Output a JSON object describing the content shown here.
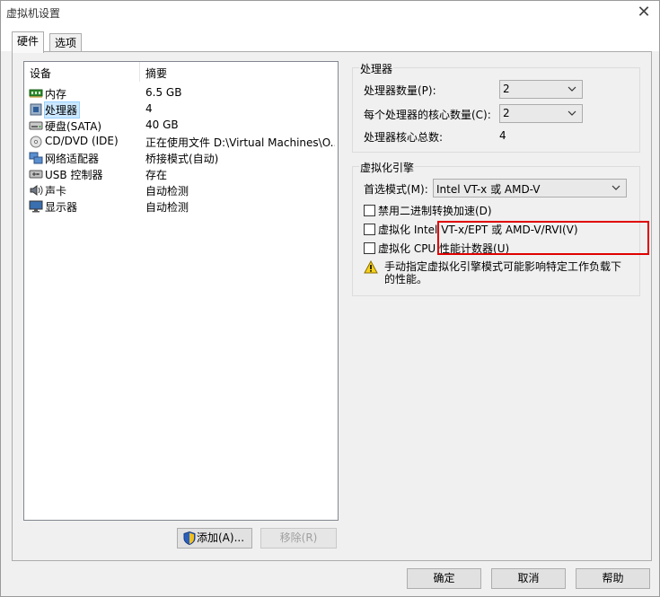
{
  "window": {
    "title": "虚拟机设置",
    "close_glyph": "✕"
  },
  "tabs": [
    {
      "label": "硬件",
      "active": true
    },
    {
      "label": "选项",
      "active": false
    }
  ],
  "device_list": {
    "col_device": "设备",
    "col_summary": "摘要",
    "rows": [
      {
        "icon": "memory-icon",
        "name": "内存",
        "summary": "6.5 GB"
      },
      {
        "icon": "processor-icon",
        "name": "处理器",
        "summary": "4",
        "selected": true
      },
      {
        "icon": "hard-disk-icon",
        "name": "硬盘(SATA)",
        "summary": "40 GB"
      },
      {
        "icon": "cd-dvd-icon",
        "name": "CD/DVD (IDE)",
        "summary": "正在使用文件 D:\\Virtual Machines\\O..."
      },
      {
        "icon": "network-adapter-icon",
        "name": "网络适配器",
        "summary": "桥接模式(自动)"
      },
      {
        "icon": "usb-controller-icon",
        "name": "USB 控制器",
        "summary": "存在"
      },
      {
        "icon": "sound-card-icon",
        "name": "声卡",
        "summary": "自动检测"
      },
      {
        "icon": "display-icon",
        "name": "显示器",
        "summary": "自动检测"
      }
    ]
  },
  "buttons": {
    "add": "添加(A)...",
    "remove": "移除(R)",
    "ok": "确定",
    "cancel": "取消",
    "help": "帮助"
  },
  "processors": {
    "group_title": "处理器",
    "count_label": "处理器数量(P):",
    "count_value": "2",
    "cores_label": "每个处理器的核心数量(C):",
    "cores_value": "2",
    "total_label": "处理器核心总数:",
    "total_value": "4"
  },
  "virtualization": {
    "group_title": "虚拟化引擎",
    "mode_label": "首选模式(M):",
    "mode_value": "Intel VT-x 或 AMD-V",
    "opt_disable_binary": "禁用二进制转换加速(D)",
    "opt_vtx_ept": "虚拟化 Intel VT-x/EPT 或 AMD-V/RVI(V)",
    "opt_cpu_counters": "虚拟化 CPU 性能计数器(U)",
    "warning": "手动指定虚拟化引擎模式可能影响特定工作负载下的性能。"
  },
  "colors": {
    "highlight_border": "#e00000",
    "selection": "#cce8ff"
  }
}
